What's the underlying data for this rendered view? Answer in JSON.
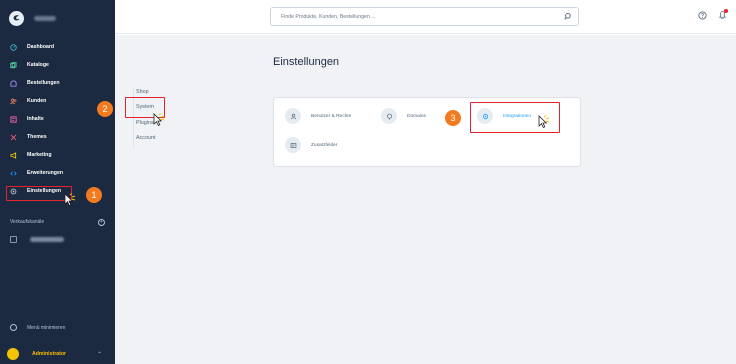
{
  "sidebar": {
    "nav": [
      {
        "label": "Dashboard",
        "icon": "dashboard-icon"
      },
      {
        "label": "Kataloge",
        "icon": "catalog-icon"
      },
      {
        "label": "Bestellungen",
        "icon": "orders-icon"
      },
      {
        "label": "Kunden",
        "icon": "customers-icon"
      },
      {
        "label": "Inhalte",
        "icon": "content-icon"
      },
      {
        "label": "Themes",
        "icon": "themes-icon"
      },
      {
        "label": "Marketing",
        "icon": "marketing-icon"
      },
      {
        "label": "Erweiterungen",
        "icon": "extensions-icon"
      },
      {
        "label": "Einstellungen",
        "icon": "settings-icon"
      }
    ],
    "channels_label": "Verkaufskanäle",
    "minimize_label": "Menü minimieren",
    "user_name": "Administrator"
  },
  "topbar": {
    "search_placeholder": "Finde Produkte, Kunden, Bestellungen ..."
  },
  "main": {
    "title": "Einstellungen",
    "subnav": [
      "Shop",
      "System",
      "Plugins",
      "Account"
    ],
    "tiles": [
      {
        "label": "Benutzer & Rechte",
        "icon": "user-icon"
      },
      {
        "label": "Domains",
        "icon": "globe-icon"
      },
      {
        "label": "Integrationen",
        "icon": "gear-icon"
      },
      {
        "label": "Zusatzfelder",
        "icon": "custom-fields-icon"
      }
    ]
  },
  "steps": [
    "1",
    "2",
    "3"
  ],
  "colors": {
    "sidebar_bg": "#1b2a40",
    "accent": "#189eff",
    "highlight": "#e0242b",
    "step_badge": "#f47a1f"
  }
}
